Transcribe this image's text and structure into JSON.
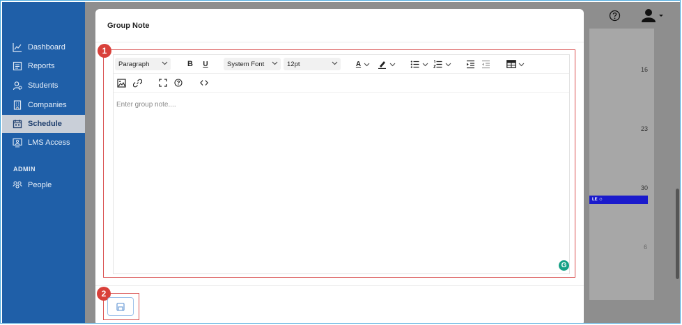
{
  "sidebar": {
    "items": [
      {
        "label": "Dashboard",
        "icon": "chart-line-icon",
        "active": false
      },
      {
        "label": "Reports",
        "icon": "report-icon",
        "active": false
      },
      {
        "label": "Students",
        "icon": "students-icon",
        "active": false
      },
      {
        "label": "Companies",
        "icon": "building-icon",
        "active": false
      },
      {
        "label": "Schedule",
        "icon": "calendar-icon",
        "active": true
      },
      {
        "label": "LMS Access",
        "icon": "monitor-user-icon",
        "active": false
      }
    ],
    "admin_label": "ADMIN",
    "admin_items": [
      {
        "label": "People",
        "icon": "people-icon"
      }
    ]
  },
  "background": {
    "days": [
      "16",
      "23",
      "30",
      "6"
    ],
    "event_label": "LE"
  },
  "modal": {
    "title": "Group Note",
    "toolbar": {
      "block_format": "Paragraph",
      "bold": "B",
      "underline": "U",
      "font_family": "System Font",
      "font_size": "12pt",
      "text_color": "A"
    },
    "editor_placeholder": "Enter group note....",
    "grammarly": "G"
  },
  "callouts": [
    "1",
    "2"
  ],
  "colors": {
    "sidebar": "#1f5fa8",
    "callout": "#d9403a",
    "grammarly": "#15a085",
    "event": "#1a1acc"
  }
}
